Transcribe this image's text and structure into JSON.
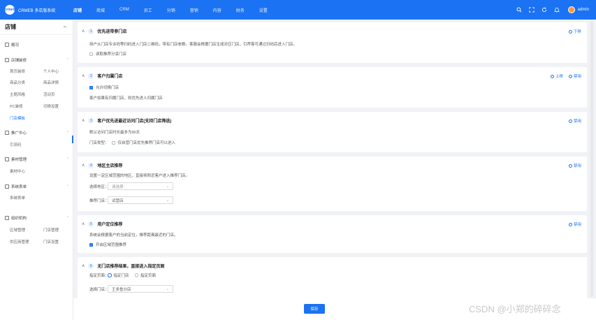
{
  "brand": {
    "logo": "crmeb",
    "name": "CRMEB 多店版系统"
  },
  "topnav": [
    "店铺",
    "商城",
    "CRM",
    "员工",
    "分销",
    "营销",
    "内容",
    "财务",
    "设置"
  ],
  "user": {
    "name": "admin"
  },
  "sidebar": {
    "title": "店铺",
    "collapse_glyph": "⇤",
    "overview": "概况",
    "groups": [
      {
        "label": "店铺装修",
        "items": [
          "首页装修",
          "个人中心",
          "商品分类",
          "商品详情",
          "主题风格",
          "活动页",
          "PC装修",
          "切换设置",
          "门店模板"
        ]
      },
      {
        "label": "推广中心",
        "items": [
          "引流码"
        ]
      },
      {
        "label": "素材管理",
        "items": [
          "素材中心"
        ]
      },
      {
        "label": "系统表单",
        "items": [
          "系统表单"
        ]
      },
      {
        "label": "组织机构",
        "items": [
          "区域管理",
          "门店管理",
          "供应商管理",
          "门店设置"
        ]
      }
    ]
  },
  "cards": [
    {
      "num": "1",
      "title": "优先进带参门店",
      "actions": [
        "下移"
      ],
      "desc": "用户从门店专业码等扫码进入门店二维码，带有门店参数。客服会根据门店生成对应门店，引荐客可通过扫码后进入门店。",
      "checkbox": {
        "label": "读取推荐分享门店",
        "checked": false
      }
    },
    {
      "num": "2",
      "title": "客户归属门店",
      "actions": [
        "上移",
        "禁用"
      ],
      "checkbox": {
        "label": "允许切换门店",
        "checked": true
      },
      "desc": "客户如果有归属门店，则优先进入归属门店"
    },
    {
      "num": "3",
      "title": "客户优先进最近访问门店(支持门店筛选)",
      "actions": [
        "禁用"
      ],
      "desc": "默认访问门店时长最多为90天",
      "form_label": "门店类型：",
      "checkbox": {
        "label": "仅自营门店优先推荐门店可以进入",
        "checked": false
      }
    },
    {
      "num": "4",
      "title": "地区主店推荐",
      "actions": [
        "禁用"
      ],
      "desc": "设置一定区域范围的地区，直接将附近客户进入推荐门店。",
      "fields": [
        {
          "label": "选择地区：",
          "placeholder": "请选择",
          "value": ""
        },
        {
          "label": "推荐门店：",
          "placeholder": "",
          "value": "试营店"
        }
      ]
    },
    {
      "num": "5",
      "title": "用户定位推荐",
      "actions": [
        "禁用"
      ],
      "desc": "系统会根据客户的当前定位，推荐距离最近的门店。",
      "checkbox": {
        "label": "开启区域范围推荐",
        "checked": true
      }
    },
    {
      "num": "6",
      "title": "无门店推荐结果，直接进入指定页面",
      "actions": [],
      "radio": {
        "label": "指定页面：",
        "options": [
          "指定门店",
          "指定页面"
        ],
        "selected": 0
      },
      "field": {
        "label": "选择门店：",
        "value": "王多鱼分店"
      }
    }
  ],
  "save_label": "保存",
  "watermark": "CSDN @小郑的碎碎念"
}
